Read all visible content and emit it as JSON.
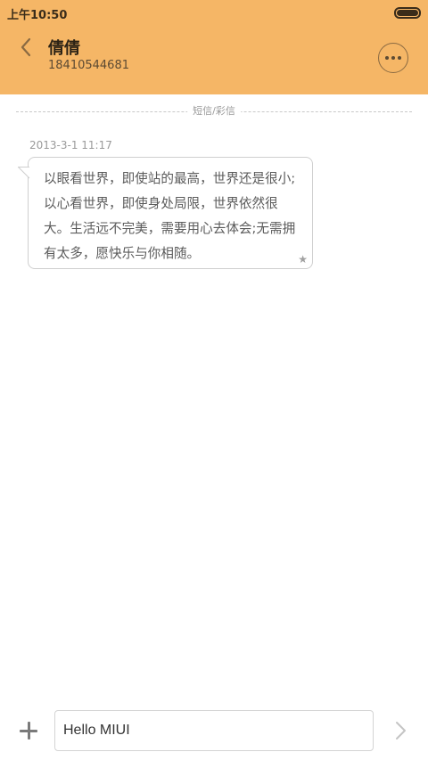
{
  "status_bar": {
    "time": "上午10:50",
    "battery_level": 1.0
  },
  "header": {
    "back_icon": "chevron-left-icon",
    "contact_name": "倩倩",
    "contact_number": "18410544681",
    "more_icon": "more-horizontal-icon"
  },
  "divider": {
    "label": "短信/彩信"
  },
  "message": {
    "timestamp": "2013-3-1 11:17",
    "text": "以眼看世界，即使站的最高，世界还是很小;以心看世界，即使身处局限，世界依然很大。生活远不完美，需要用心去体会;无需拥有太多，愿快乐与你相随。",
    "star_icon": "star-icon",
    "star_glyph": "★"
  },
  "composer": {
    "add_icon": "plus-icon",
    "input_value": "Hello MIUI",
    "send_icon": "chevron-right-icon"
  },
  "colors": {
    "header_bg": "#f5b666",
    "bubble_border": "#cfcfcf",
    "text_gray": "#5b5b5b"
  }
}
